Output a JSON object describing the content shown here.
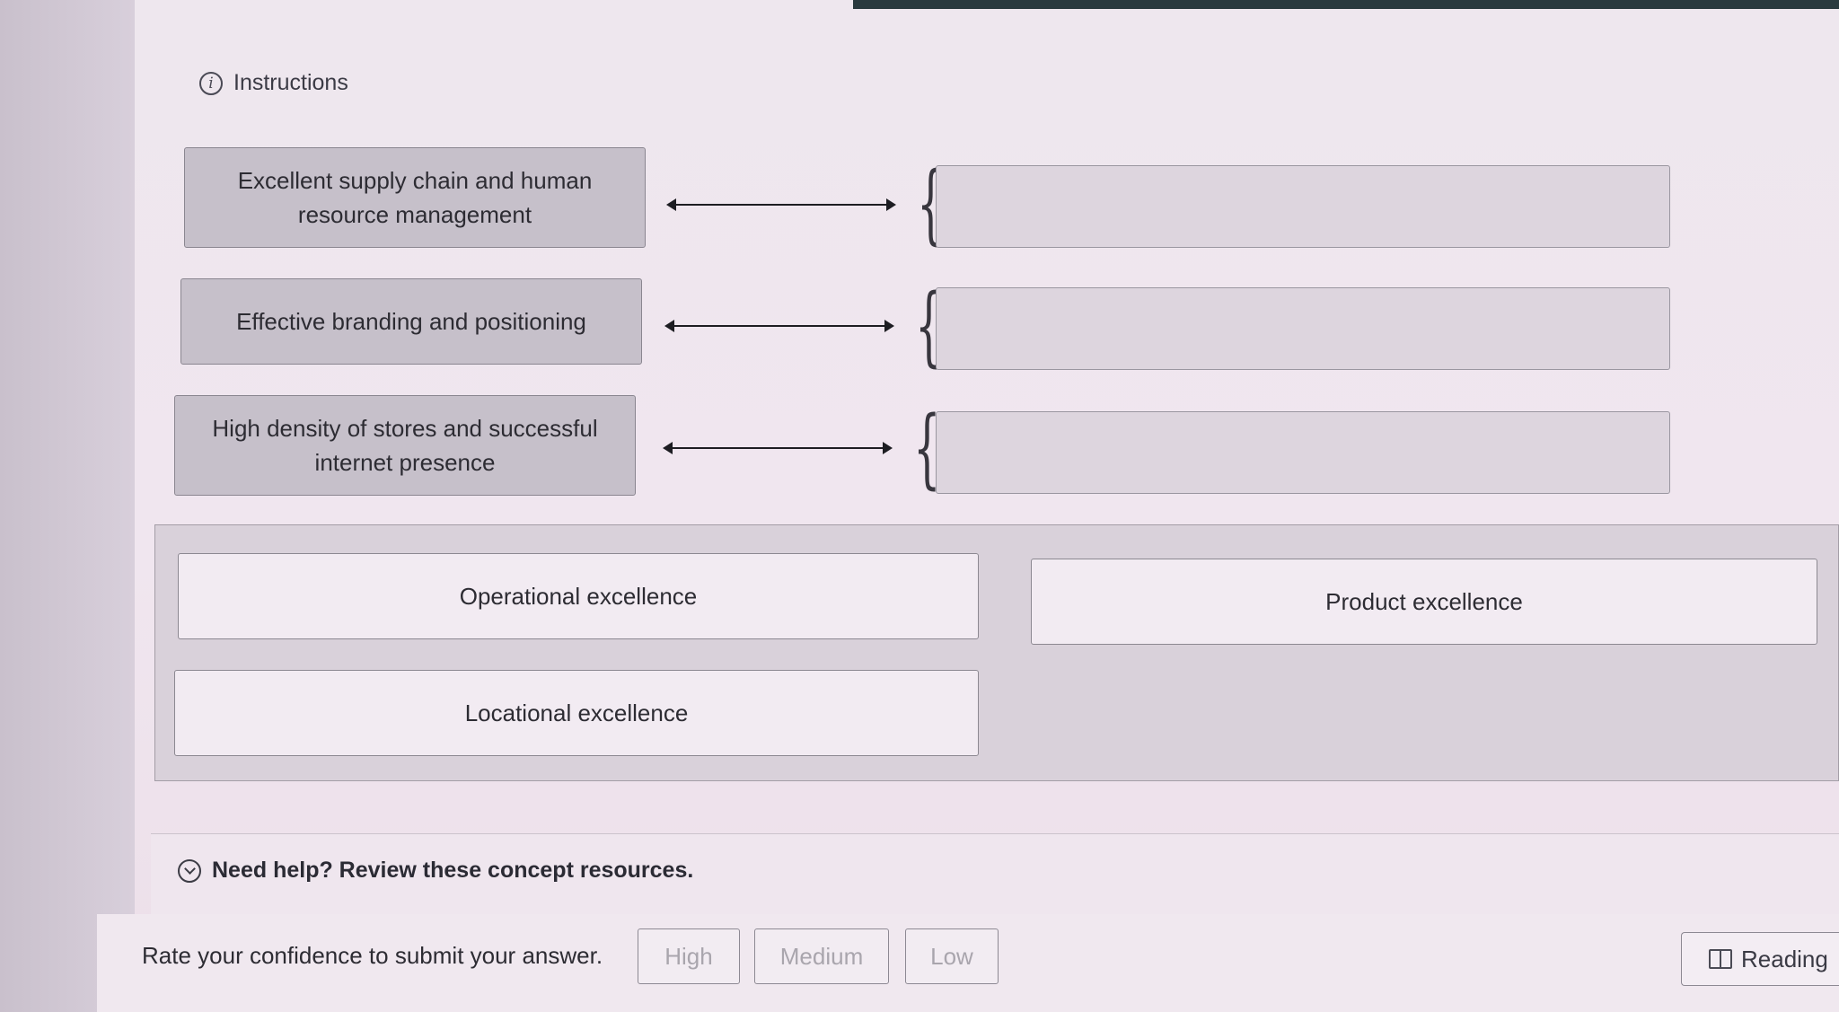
{
  "instructions": {
    "label": "Instructions",
    "icon": "info-icon"
  },
  "prompts": [
    {
      "text": "Excellent supply chain and human resource management"
    },
    {
      "text": "Effective branding and positioning"
    },
    {
      "text": "High density of stores and successful internet presence"
    }
  ],
  "dropzones": [
    {
      "value": ""
    },
    {
      "value": ""
    },
    {
      "value": ""
    }
  ],
  "choices": [
    {
      "label": "Operational excellence"
    },
    {
      "label": "Product excellence"
    },
    {
      "label": "Locational excellence"
    }
  ],
  "help": {
    "text": "Need help? Review these concept resources.",
    "icon": "chevron-down-icon"
  },
  "confidence": {
    "prompt": "Rate your confidence to submit your answer.",
    "options": [
      "High",
      "Medium",
      "Low"
    ]
  },
  "reading": {
    "label": "Reading",
    "icon": "book-icon"
  }
}
